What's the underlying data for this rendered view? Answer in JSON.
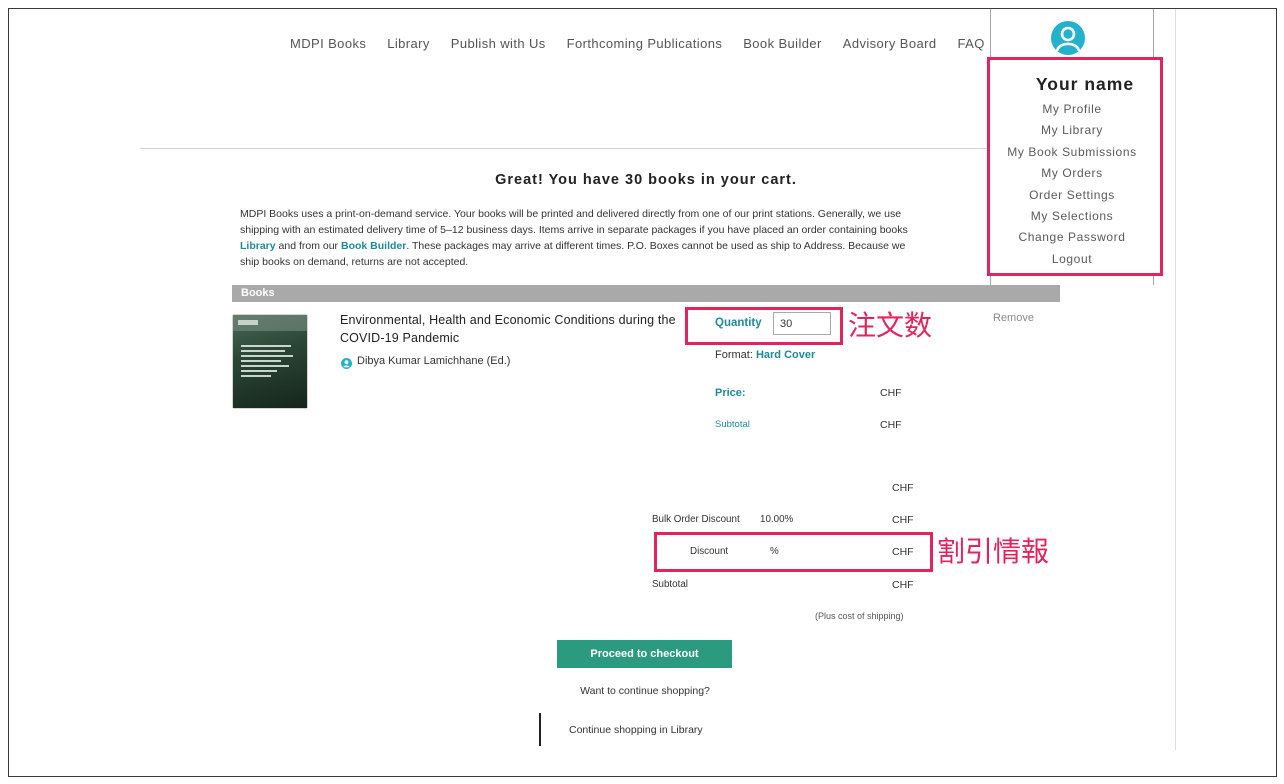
{
  "colors": {
    "accent": "#1f8a98",
    "annotation": "#e3245c",
    "button_bg": "#2b9b80",
    "avatar": "#24b1cc",
    "section_bar": "#a9a9a9"
  },
  "icons": {
    "avatar": "user-avatar-icon",
    "author": "person-icon",
    "cover": "book-cover-image"
  },
  "nav": {
    "items": [
      "MDPI Books",
      "Library",
      "Publish with Us",
      "Forthcoming Publications",
      "Book Builder",
      "Advisory Board",
      "FAQ"
    ]
  },
  "user_menu": {
    "name": "Your name",
    "items": [
      "My Profile",
      "My Library",
      "My Book Submissions",
      "My Orders",
      "Order Settings",
      "My Selections",
      "Change Password",
      "Logout"
    ]
  },
  "cart": {
    "heading": "Great! You have 30 books in your cart.",
    "notice": {
      "line1": "MDPI Books uses a print-on-demand service. Your books will be printed and delivered directly from one of our print stations. Generally, we use",
      "line2": "shipping with an estimated delivery time of 5–12 business days. Items arrive in separate packages if you have placed an order containing books",
      "line3_link1": "Library",
      "line3_text1": " and from our ",
      "line3_link2": "Book Builder",
      "line3_text2": ". These packages may arrive at different times. P.O. Boxes cannot be used as ship to Address. Because we",
      "line4": "ship books on demand, returns are not accepted."
    },
    "section_title": "Books",
    "item": {
      "title": "Environmental, Health and Economic Conditions during the COVID-19 Pandemic",
      "author": "Dibya Kumar Lamichhane (Ed.)",
      "quantity_label": "Quantity",
      "quantity_value": "30",
      "remove_label": "Remove",
      "format_label": "Format: ",
      "format_value": "Hard Cover",
      "price_label": "Price:",
      "price_currency": "CHF",
      "subtotal_label": "Subtotal",
      "subtotal_currency": "CHF"
    },
    "summary": {
      "total_currency": "CHF",
      "bulk_discount_label": "Bulk Order Discount",
      "bulk_discount_rate": "10.00%",
      "bulk_discount_currency": "CHF",
      "discount_label": "Discount",
      "discount_rate": "%",
      "discount_currency": "CHF",
      "subtotal_label": "Subtotal",
      "subtotal_currency": "CHF",
      "shipping_note": "(Plus cost of shipping)"
    },
    "checkout_button": "Proceed to checkout",
    "continue_prompt": "Want to continue shopping?",
    "continue_link": "Continue shopping in Library"
  },
  "annotations": {
    "quantity_label": "注文数",
    "discount_label": "割引情報"
  }
}
